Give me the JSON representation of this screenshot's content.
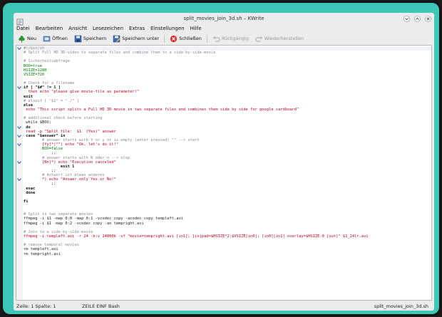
{
  "window": {
    "title": "split_movies_join_3d.sh – KWrite"
  },
  "menubar": {
    "items": [
      "Datei",
      "Bearbeiten",
      "Ansicht",
      "Lesezeichen",
      "Extras",
      "Einstellungen",
      "Hilfe"
    ]
  },
  "toolbar": {
    "new_label": "Neu",
    "open_label": "Öffnen",
    "save_label": "Speichern",
    "save_as_label": "Speichern unter",
    "close_label": "Schließen",
    "undo_label": "Rückgängig",
    "redo_label": "Wiederherstellen"
  },
  "editor": {
    "lines": [
      {
        "text": "#!/bin/sh",
        "cls": "c-comment",
        "fold": true
      },
      {
        "text": "# Split Full HD 3D-video to separate files and combine them to a side-by-side-movie",
        "cls": "c-comment"
      },
      {
        "text": "",
        "cls": ""
      },
      {
        "text": "# Sicherheitsabfrage",
        "cls": "c-comment"
      },
      {
        "text": "BOO=true",
        "cls": "c-var"
      },
      {
        "text": "HSIZE=1280",
        "cls": "c-var"
      },
      {
        "text": "VSIZE=720",
        "cls": "c-var"
      },
      {
        "text": "",
        "cls": ""
      },
      {
        "text": "# Check for a filename",
        "cls": "c-comment"
      },
      {
        "text": "if [ \"$#\" != 1 ]",
        "cls": "c-kw",
        "fold": true
      },
      {
        "text": "  then echo \"please give movie-file as parameter!\"",
        "cls": "c-str"
      },
      {
        "text": "exit",
        "cls": "c-kw"
      },
      {
        "text": "# elseif [ \"$1\" = \"./\" ]",
        "cls": "c-comment"
      },
      {
        "text": "else",
        "cls": "c-kw"
      },
      {
        "text": " echo \"This script splits a Full HD 3D-movie in two separate files and combines them side by side for google cardboard\"",
        "cls": "c-str"
      },
      {
        "text": "",
        "cls": ""
      },
      {
        "text": "# additional check before starting",
        "cls": "c-comment"
      },
      {
        "text": " while $BOO;",
        "cls": "c-cmd"
      },
      {
        "text": " do",
        "cls": "c-kw",
        "fold": true
      },
      {
        "text": " read -p \"Split file:  $1  (Yes)\" answer",
        "cls": "c-str"
      },
      {
        "text": " case \"$answer\" in",
        "cls": "c-kw",
        "fold": true
      },
      {
        "text": "        # answer starts with Y or y or is empty (enter pressed) \"\" --> start",
        "cls": "c-comment"
      },
      {
        "text": "        [Yy]*|\"\") echo \"Ok, let's do it!\"",
        "cls": "c-str",
        "fold": true
      },
      {
        "text": "        BOO=false",
        "cls": "c-var"
      },
      {
        "text": "            ;;",
        "cls": "c-cmd"
      },
      {
        "text": "        # answer starts with N oder n --> stop",
        "cls": "c-comment"
      },
      {
        "text": "        [Nn]*) echo \"Execution canceled\"",
        "cls": "c-str",
        "fold": true
      },
      {
        "text": "                exit 1",
        "cls": "c-kw"
      },
      {
        "text": "            ;;",
        "cls": "c-cmd"
      },
      {
        "text": "        # Antwort ist etwas anderes",
        "cls": "c-comment"
      },
      {
        "text": "        *) echo \"Answer only Yes or No!\"",
        "cls": "c-str",
        "fold": true
      },
      {
        "text": "            ;;",
        "cls": "c-cmd"
      },
      {
        "text": " esac",
        "cls": "c-kw"
      },
      {
        "text": " done",
        "cls": "c-kw"
      },
      {
        "text": "",
        "cls": ""
      },
      {
        "text": "fi",
        "cls": "c-kw"
      },
      {
        "text": "",
        "cls": ""
      },
      {
        "text": "",
        "cls": ""
      },
      {
        "text": "# Split in two separate movies",
        "cls": "c-comment"
      },
      {
        "text": "ffmpeg -i $1 -map 0:0 -map 0:1 -vcodec copy -acodec copy templeft.avi",
        "cls": "c-cmd"
      },
      {
        "text": "ffmpeg -i $1 -map 0:2 -vcodec copy -an tempright.avi",
        "cls": "c-cmd"
      },
      {
        "text": "",
        "cls": ""
      },
      {
        "text": "# Join to a side-by-side-movie",
        "cls": "c-comment"
      },
      {
        "text": "ffmpeg -i templeft.avi -r 24 -b:v 24000k -vf \"movie=tempright.avi [in1]; [in]pad=$HSIZE*2:$VSIZE[in0]; [in0][in1] overlay=$HSIZE:0 [out]\" $1_24lr.avi",
        "cls": "c-str"
      },
      {
        "text": "",
        "cls": ""
      },
      {
        "text": "# remove temporal movies",
        "cls": "c-comment"
      },
      {
        "text": "rm templeft.avi",
        "cls": "c-cmd"
      },
      {
        "text": "rm tempright.avi",
        "cls": "c-cmd"
      }
    ]
  },
  "statusbar": {
    "position": "Zeile: 1 Spalte: 1",
    "mode": "ZEILE  EINF  Bash",
    "filename": "split_movies_join_3d.sh"
  }
}
